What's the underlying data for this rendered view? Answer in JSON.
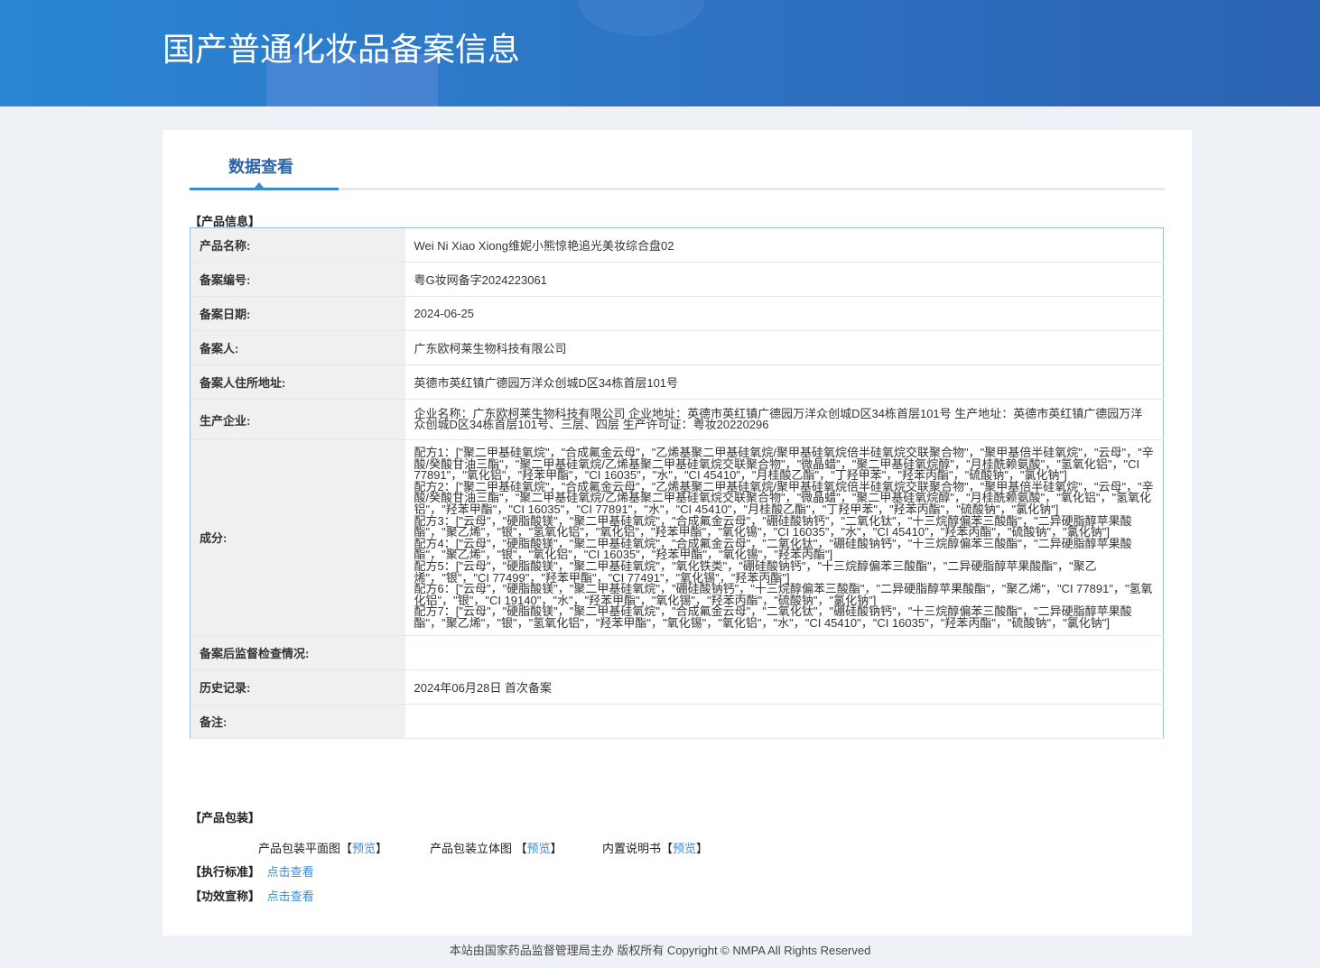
{
  "header": {
    "title": "国产普通化妆品备案信息"
  },
  "tab": {
    "label": "数据查看"
  },
  "sections": {
    "product_info": "【产品信息】",
    "packaging": "【产品包装】",
    "standard": "【执行标准】",
    "claims": "【功效宣称】"
  },
  "fields": [
    {
      "label": "产品名称:",
      "value": "Wei Ni Xiao Xiong维妮小熊惊艳追光美妆综合盘02"
    },
    {
      "label": "备案编号:",
      "value": "粤G妆网备字2024223061"
    },
    {
      "label": "备案日期:",
      "value": "2024-06-25"
    },
    {
      "label": "备案人:",
      "value": "广东欧柯莱生物科技有限公司"
    },
    {
      "label": "备案人住所地址:",
      "value": "英德市英红镇广德园万洋众创城D区34栋首层101号"
    },
    {
      "label": "生产企业:",
      "value": "企业名称：广东欧柯莱生物科技有限公司 企业地址：英德市英红镇广德园万洋众创城D区34栋首层101号 生产地址：英德市英红镇广德园万洋众创城D区34栋首层101号、三层、四层 生产许可证：粤妆20220296"
    },
    {
      "label": "成分:",
      "formulas": [
        "配方1：[\"聚二甲基硅氧烷\"，\"合成氟金云母\"，\"乙烯基聚二甲基硅氧烷/聚甲基硅氧烷倍半硅氧烷交联聚合物\"，\"聚甲基倍半硅氧烷\"，\"云母\"，\"辛酸/癸酸甘油三酯\"，\"聚二甲基硅氧烷/乙烯基聚二甲基硅氧烷交联聚合物\"，\"微晶蜡\"，\"聚二甲基硅氧烷醇\"，\"月桂酰赖氨酸\"，\"氢氧化铝\"，\"CI 77891\"，\"氧化铝\"，\"羟苯甲酯\"，\"CI 16035\"，\"水\"，\"CI 45410\"，\"月桂酸乙酯\"，\"丁羟甲苯\"，\"羟苯丙酯\"，\"硫酸钠\"，\"氯化钠\"]",
        "配方2：[\"聚二甲基硅氧烷\"，\"合成氟金云母\"，\"乙烯基聚二甲基硅氧烷/聚甲基硅氧烷倍半硅氧烷交联聚合物\"，\"聚甲基倍半硅氧烷\"，\"云母\"，\"辛酸/癸酸甘油三酯\"，\"聚二甲基硅氧烷/乙烯基聚二甲基硅氧烷交联聚合物\"，\"微晶蜡\"，\"聚二甲基硅氧烷醇\"，\"月桂酰赖氨酸\"，\"氧化铝\"，\"氢氧化铝\"，\"羟苯甲酯\"，\"CI 16035\"，\"CI 77891\"，\"水\"，\"CI 45410\"，\"月桂酸乙酯\"，\"丁羟甲苯\"，\"羟苯丙酯\"，\"硫酸钠\"，\"氯化钠\"]",
        "配方3：[\"云母\"，\"硬脂酸镁\"，\"聚二甲基硅氧烷\"，\"合成氟金云母\"，\"硼硅酸钠钙\"，\"二氧化钛\"，\"十三烷醇偏苯三酸酯\"，\"二异硬脂醇苹果酸酯\"，\"聚乙烯\"，\"银\"，\"氢氧化铝\"，\"氧化铝\"，\"羟苯甲酯\"，\"氧化锡\"，\"CI 16035\"，\"水\"，\"CI 45410\"，\"羟苯丙酯\"，\"硫酸钠\"，\"氯化钠\"]",
        "配方4：[\"云母\"，\"硬脂酸镁\"，\"聚二甲基硅氧烷\"，\"合成氟金云母\"，\"二氧化钛\"，\"硼硅酸钠钙\"，\"十三烷醇偏苯三酸酯\"，\"二异硬脂醇苹果酸酯\"，\"聚乙烯\"，\"银\"，\"氧化铝\"，\"CI 16035\"，\"羟苯甲酯\"，\"氧化锡\"，\"羟苯丙酯\"]",
        "配方5：[\"云母\"，\"硬脂酸镁\"，\"聚二甲基硅氧烷\"，\"氧化铁类\"，\"硼硅酸钠钙\"，\"十三烷醇偏苯三酸酯\"，\"二异硬脂醇苹果酸酯\"，\"聚乙烯\"，\"银\"，\"CI 77499\"，\"羟苯甲酯\"，\"CI 77491\"，\"氧化锡\"，\"羟苯丙酯\"]",
        "配方6：[\"云母\"，\"硬脂酸镁\"，\"聚二甲基硅氧烷\"，\"硼硅酸钠钙\"，\"十三烷醇偏苯三酸酯\"，\"二异硬脂醇苹果酸酯\"，\"聚乙烯\"，\"CI 77891\"，\"氢氧化铝\"，\"银\"，\"CI 19140\"，\"水\"，\"羟苯甲酯\"，\"氧化锡\"，\"羟苯丙酯\"，\"硫酸钠\"，\"氯化钠\"]",
        "配方7：[\"云母\"，\"硬脂酸镁\"，\"聚二甲基硅氧烷\"，\"合成氟金云母\"，\"二氧化钛\"，\"硼硅酸钠钙\"，\"十三烷醇偏苯三酸酯\"，\"二异硬脂醇苹果酸酯\"，\"聚乙烯\"，\"银\"，\"氢氧化铝\"，\"羟苯甲酯\"，\"氧化锡\"，\"氧化铝\"，\"水\"，\"CI 45410\"，\"CI 16035\"，\"羟苯丙酯\"，\"硫酸钠\"，\"氯化钠\"]"
      ]
    },
    {
      "label": "备案后监督检查情况:",
      "value": ""
    },
    {
      "label": "历史记录:",
      "value": "2024年06月28日 首次备案"
    },
    {
      "label": "备注:",
      "value": ""
    }
  ],
  "packaging": {
    "items": [
      {
        "label": "产品包装平面图",
        "open": "【",
        "link": "预览",
        "close": "】"
      },
      {
        "label": "产品包装立体图 ",
        "open": "【",
        "link": "预览",
        "close": "】"
      },
      {
        "label": "内置说明书",
        "open": "【",
        "link": "预览",
        "close": "】"
      }
    ],
    "view_link": "点击查看"
  },
  "footer": {
    "text": "本站由国家药品监督管理局主办 版权所有 Copyright © NMPA All Rights Reserved"
  }
}
